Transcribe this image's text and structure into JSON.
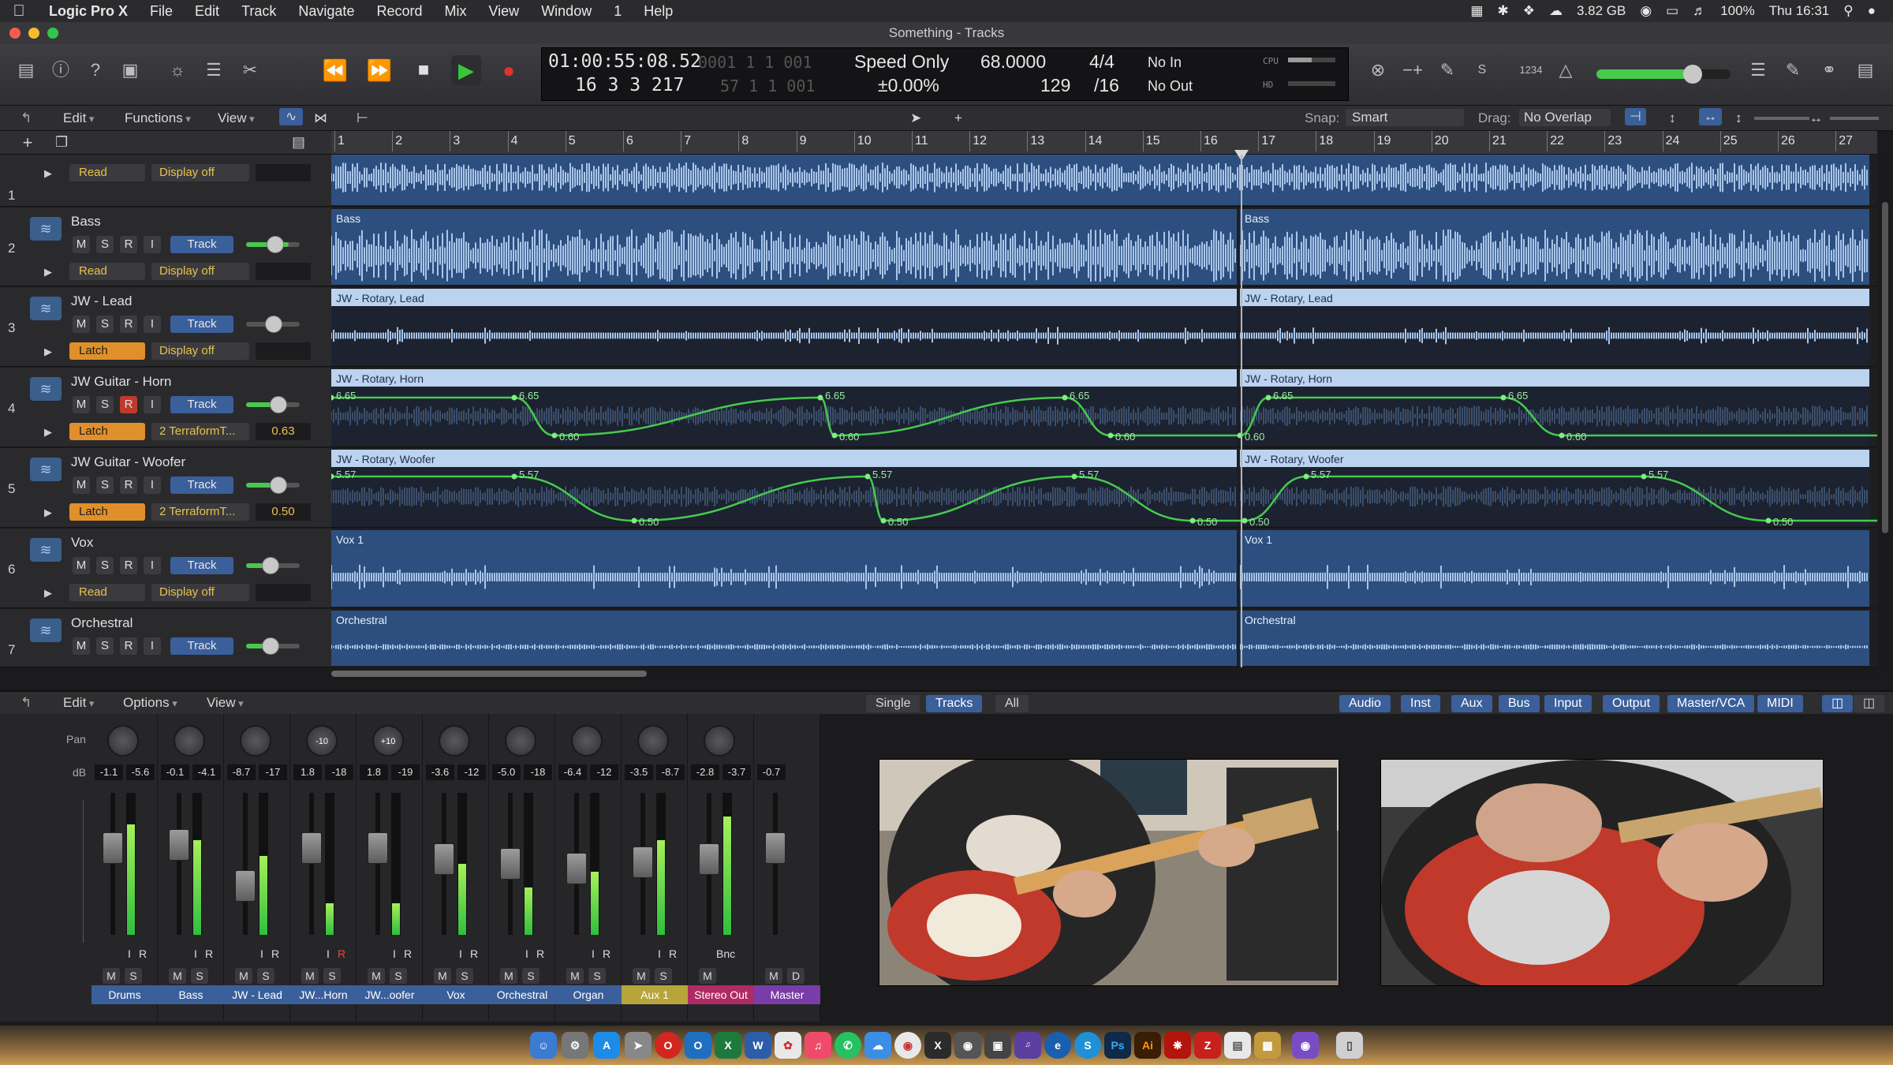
{
  "menubar": {
    "app": "Logic Pro X",
    "items": [
      "File",
      "Edit",
      "Track",
      "Navigate",
      "Record",
      "Mix",
      "View",
      "Window",
      "1",
      "Help"
    ],
    "memory": "3.82 GB",
    "battery": "100%",
    "clock": "Thu 16:31"
  },
  "window": {
    "title": "Something - Tracks"
  },
  "lcd": {
    "time": "01:00:55:08.52",
    "bars": "16  3  3  217",
    "bars_top_dim": "0001  1  1  001",
    "bars_bot_dim": "57  1  1  001",
    "mode": "Speed Only",
    "mode_sub": "±0.00%",
    "tempo": "68.0000",
    "tempo_sub": "129",
    "sig": "4/4",
    "sig_sub": "/16",
    "in": "No In",
    "out": "No Out",
    "cpu": "CPU",
    "hd": "HD"
  },
  "tracks_toolbar": {
    "edit": "Edit",
    "functions": "Functions",
    "view": "View",
    "snap_label": "Snap:",
    "snap_value": "Smart",
    "drag_label": "Drag:",
    "drag_value": "No Overlap"
  },
  "ruler": [
    "1",
    "2",
    "3",
    "4",
    "5",
    "6",
    "7",
    "8",
    "9",
    "10",
    "11",
    "12",
    "13",
    "14",
    "15",
    "16",
    "17",
    "18",
    "19",
    "20",
    "21",
    "22",
    "23",
    "24",
    "25",
    "26",
    "27"
  ],
  "tracks": [
    {
      "num": "1",
      "name": "",
      "mode": "Read",
      "param": "Display off",
      "val": ""
    },
    {
      "num": "2",
      "name": "Bass",
      "mode": "Read",
      "param": "Display off",
      "val": "",
      "r1": "Bass",
      "r2": "Bass"
    },
    {
      "num": "3",
      "name": "JW - Lead",
      "mode": "Latch",
      "param": "Display off",
      "val": "",
      "r1": "JW - Rotary, Lead",
      "r2": "JW - Rotary, Lead"
    },
    {
      "num": "4",
      "name": "JW Guitar - Horn",
      "mode": "Latch",
      "param": "2 TerraformT...",
      "val": "0.63",
      "r1": "JW - Rotary, Horn",
      "r2": "JW - Rotary, Horn"
    },
    {
      "num": "5",
      "name": "JW Guitar - Woofer",
      "mode": "Latch",
      "param": "2 TerraformT...",
      "val": "0.50",
      "r1": "JW - Rotary, Woofer",
      "r2": "JW - Rotary, Woofer"
    },
    {
      "num": "6",
      "name": "Vox",
      "mode": "Read",
      "param": "Display off",
      "val": "",
      "r1": "Vox 1",
      "r2": "Vox 1"
    },
    {
      "num": "7",
      "name": "Orchestral",
      "mode": "",
      "param": "",
      "val": "",
      "r1": "Orchestral",
      "r2": "Orchestral"
    }
  ],
  "msri": [
    "M",
    "S",
    "R",
    "I"
  ],
  "track_btn": "Track",
  "horn_points": [
    "6.65",
    "6.65",
    "0.60",
    "6.65",
    "0.60",
    "6.65",
    "0.60",
    "0.60",
    "6.65",
    "6.65",
    "0.60"
  ],
  "woofer_points": [
    "5.57",
    "5.57",
    "0.50",
    "5.57",
    "0.50",
    "5.57",
    "0.50",
    "0.50",
    "5.57",
    "5.57",
    "0.50"
  ],
  "mixer_toolbar": {
    "edit": "Edit",
    "options": "Options",
    "view": "View",
    "single": "Single",
    "tracks": "Tracks",
    "all": "All",
    "filters": [
      "Audio",
      "Inst",
      "Aux",
      "Bus",
      "Input",
      "Output",
      "Master/VCA",
      "MIDI"
    ]
  },
  "mixer_pan_label": "Pan",
  "mixer_db_label": "dB",
  "strips": [
    {
      "name": "Drums",
      "vol": "-1.1",
      "peak": "-5.6",
      "pan": "",
      "color": "#3a5f9a"
    },
    {
      "name": "Bass",
      "vol": "-0.1",
      "peak": "-4.1",
      "pan": "",
      "color": "#3a5f9a"
    },
    {
      "name": "JW - Lead",
      "vol": "-8.7",
      "peak": "-17",
      "pan": "",
      "color": "#3a5f9a"
    },
    {
      "name": "JW...Horn",
      "vol": "1.8",
      "peak": "-18",
      "pan": "-10",
      "color": "#3a5f9a"
    },
    {
      "name": "JW...oofer",
      "vol": "1.8",
      "peak": "-19",
      "pan": "+10",
      "color": "#3a5f9a"
    },
    {
      "name": "Vox",
      "vol": "-3.6",
      "peak": "-12",
      "pan": "",
      "color": "#3a5f9a"
    },
    {
      "name": "Orchestral",
      "vol": "-5.0",
      "peak": "-18",
      "pan": "",
      "color": "#3a5f9a"
    },
    {
      "name": "Organ",
      "vol": "-6.4",
      "peak": "-12",
      "pan": "",
      "color": "#3a5f9a"
    },
    {
      "name": "Aux 1",
      "vol": "-3.5",
      "peak": "-8.7",
      "pan": "",
      "color": "#b7a53a"
    },
    {
      "name": "Stereo Out",
      "vol": "-2.8",
      "peak": "-3.7",
      "pan": "",
      "color": "#b02a63"
    },
    {
      "name": "Master",
      "vol": "-0.7",
      "peak": "",
      "pan": "",
      "color": "#7a3ca8"
    }
  ],
  "bnc": "Bnc",
  "md": [
    "M",
    "D"
  ],
  "colors": {
    "accent": "#3a5f9a",
    "region": "#2d4f7f",
    "automation": "#47c94e",
    "latch": "#e0902a",
    "read": "#47a04a"
  }
}
